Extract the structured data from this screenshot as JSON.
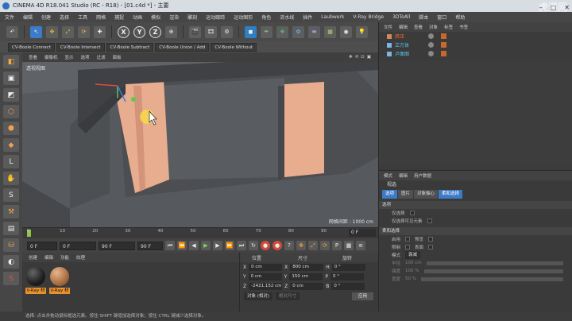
{
  "window": {
    "title": "CINEMA 4D R18.041 Studio (RC - R18) - [01.c4d *] - 主要",
    "min": "–",
    "max": "□",
    "close": "✕"
  },
  "watermark": "虎课网",
  "menu": [
    "文件",
    "编辑",
    "创建",
    "选择",
    "工具",
    "网格",
    "捕捉",
    "动画",
    "模拟",
    "渲染",
    "雕刻",
    "运动跟踪",
    "运动图形",
    "角色",
    "流水线",
    "插件",
    "Laubwerk",
    "V-Ray Bridge",
    "3DToAll",
    "脚本",
    "窗口",
    "帮助"
  ],
  "toolbar": {
    "undo": "↶",
    "move": "✥",
    "scale": "⤢",
    "rotate": "⟳",
    "x": "X",
    "y": "Y",
    "z": "Z",
    "world": "⊕"
  },
  "plugins": [
    "CV-Boole Connect",
    "CV-Boole Intersect",
    "CV-Boole Subtract",
    "CV-Boole Union / Add",
    "CV-Boole Without"
  ],
  "viewport_menu": {
    "items": [
      "查看",
      "摄像机",
      "显示",
      "选项",
      "过滤",
      "面板"
    ],
    "nav": "✥⟲⊡▣"
  },
  "viewport": {
    "label": "透视视图",
    "grid": "网格间距 : 1000 cm"
  },
  "timeline": {
    "ticks": [
      "0",
      "10",
      "20",
      "30",
      "40",
      "50",
      "60",
      "70",
      "80",
      "90"
    ],
    "frame": "0 F"
  },
  "transport": {
    "start": "0 F",
    "current": "0 F",
    "end": "90 F",
    "max": "90 F"
  },
  "materials": {
    "menu": [
      "创建",
      "编辑",
      "功能",
      "纹理"
    ],
    "items": [
      {
        "name": "V-Ray 材",
        "color": "#1e1e1e"
      },
      {
        "name": "V-Ray 材",
        "color": "#b07348"
      }
    ]
  },
  "coords": {
    "headers": [
      "位置",
      "尺寸",
      "旋转"
    ],
    "rows": [
      {
        "axis": "X",
        "pos": "0 cm",
        "size": "800 cm",
        "raxis": "H",
        "rot": "0 °"
      },
      {
        "axis": "Y",
        "pos": "0 cm",
        "size": "150 cm",
        "raxis": "P",
        "rot": "0 °"
      },
      {
        "axis": "Z",
        "pos": "-2421.152 cm",
        "size": "0 cm",
        "raxis": "B",
        "rot": "0 °"
      }
    ],
    "mode": "对象 (相对)",
    "size_mode": "绝对尺寸",
    "apply": "应用"
  },
  "object_manager": {
    "menu": [
      "文件",
      "编辑",
      "查看",
      "对象",
      "标签",
      "书签"
    ],
    "objects": [
      {
        "name": "挤压",
        "selected": true
      },
      {
        "name": "立方体",
        "selected": false
      },
      {
        "name": "卢面图",
        "selected": false
      }
    ]
  },
  "attributes": {
    "menu": [
      "模式",
      "编辑",
      "用户数据"
    ],
    "title": "视选",
    "tabs": [
      {
        "label": "选项",
        "active": true
      },
      {
        "label": "图片",
        "active": false
      },
      {
        "label": "对象轴心",
        "active": false
      },
      {
        "label": "柔和选择",
        "active": true
      }
    ],
    "section1": "选项",
    "opt_rows": [
      "仅选择",
      "仅选择可见元素"
    ],
    "section2": "柔和选择",
    "soft_rows": [
      {
        "label": "启用",
        "extra": "预览"
      },
      {
        "label": "限制",
        "extra": "表面"
      },
      {
        "label": "模式",
        "extra": "衰减"
      },
      {
        "label": "半径",
        "extra": "100 cm"
      },
      {
        "label": "强度",
        "extra": "100 %"
      },
      {
        "label": "宽度",
        "extra": "50 %"
      }
    ]
  },
  "status": "选择: 点击并拖动鼠标框选元素。按住 SHIFT 键增加选择对象；按住 CTRL 键减少选择对象。"
}
